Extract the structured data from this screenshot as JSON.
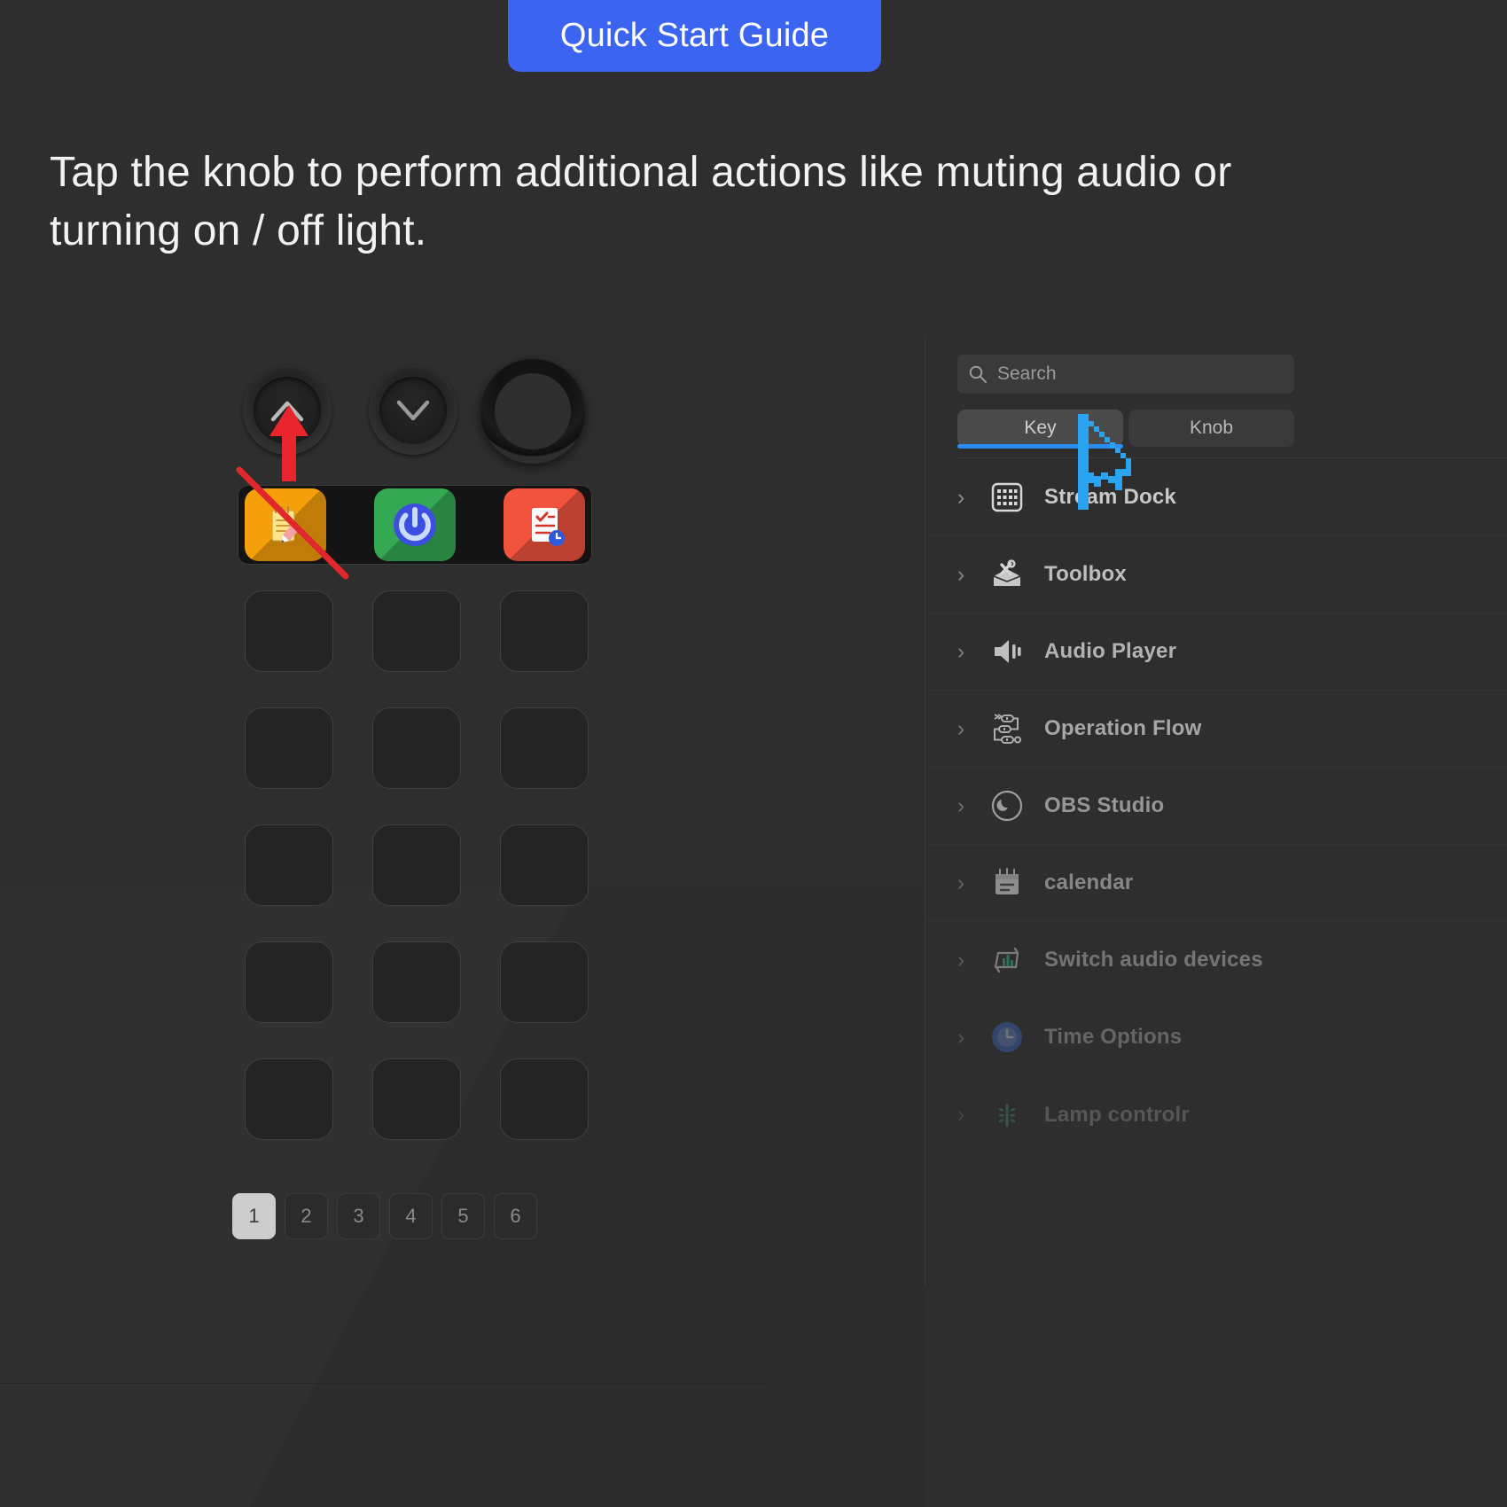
{
  "banner": {
    "title": "Quick Start Guide",
    "color": "#3b64f0"
  },
  "instruction": {
    "text": "Tap the knob to perform additional actions like muting audio or turning on / off light."
  },
  "device": {
    "knobs": [
      {
        "name": "knob-up",
        "glyph": "chevron-up"
      },
      {
        "name": "knob-down",
        "glyph": "chevron-down"
      },
      {
        "name": "rotary-knob",
        "glyph": "ring"
      }
    ],
    "top_keys": [
      {
        "name": "notes-key",
        "label": "Notes",
        "bg": "#f59f0b",
        "glyph": "notepad-pencil"
      },
      {
        "name": "power-key",
        "label": "Power",
        "bg": "#34a853",
        "glyph": "power-button"
      },
      {
        "name": "tasks-key",
        "label": "Tasks",
        "bg": "#f2533d",
        "glyph": "checklist-clock"
      }
    ],
    "empty_key_count": 15,
    "pages": [
      "1",
      "2",
      "3",
      "4",
      "5",
      "6"
    ],
    "active_page": "1"
  },
  "panel": {
    "search": {
      "placeholder": "Search",
      "value": "",
      "icon": "search-icon"
    },
    "tabs": [
      {
        "label": "Key",
        "active": true
      },
      {
        "label": "Knob",
        "active": false
      }
    ],
    "categories": [
      {
        "label": "Stream Dock",
        "icon": "keypad-grid-icon",
        "opacity": 1.0
      },
      {
        "label": "Toolbox",
        "icon": "toolbox-icon",
        "opacity": 0.93
      },
      {
        "label": "Audio Player",
        "icon": "speaker-icon",
        "opacity": 0.86
      },
      {
        "label": "Operation Flow",
        "icon": "flow-nodes-icon",
        "opacity": 0.78
      },
      {
        "label": "OBS Studio",
        "icon": "obs-logo-icon",
        "opacity": 0.68
      },
      {
        "label": "calendar",
        "icon": "calendar-icon",
        "opacity": 0.58
      },
      {
        "label": "Switch audio devices",
        "icon": "switch-audio-icon",
        "opacity": 0.46
      },
      {
        "label": "Time Options",
        "icon": "clock-badge-icon",
        "opacity": 0.36
      },
      {
        "label": "Lamp controlr",
        "icon": "lamp-icon",
        "opacity": 0.26
      }
    ]
  },
  "annotations": {
    "arrow": {
      "name": "red-up-arrow",
      "color": "#e8252a"
    },
    "strike": {
      "name": "red-strike-line",
      "color": "#e0282c"
    },
    "cursor": {
      "name": "mouse-cursor",
      "color": "#2aa3f0"
    }
  }
}
